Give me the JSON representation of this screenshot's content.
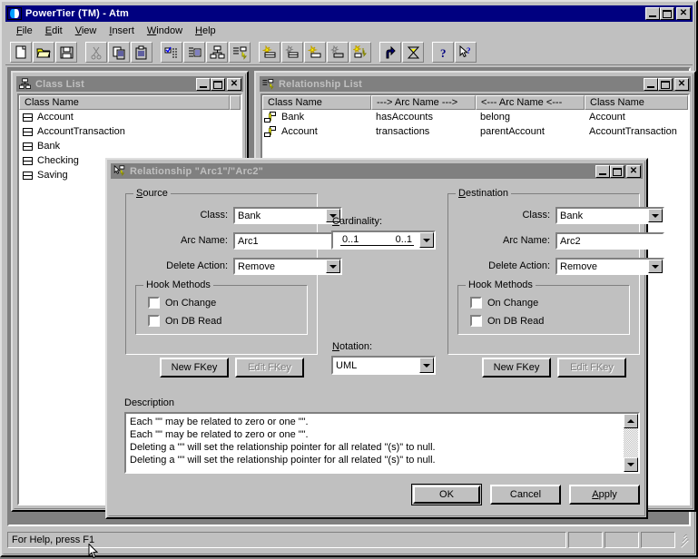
{
  "app": {
    "title": "PowerTier (TM) - Atm",
    "icon": "powertier-app-icon",
    "menus": [
      {
        "label": "File",
        "accel": "F"
      },
      {
        "label": "Edit",
        "accel": "E"
      },
      {
        "label": "View",
        "accel": "V"
      },
      {
        "label": "Insert",
        "accel": "I"
      },
      {
        "label": "Window",
        "accel": "W"
      },
      {
        "label": "Help",
        "accel": "H"
      }
    ],
    "window_buttons": [
      "minimize",
      "maximize",
      "close"
    ]
  },
  "toolbar": {
    "buttons": [
      {
        "name": "new-icon"
      },
      {
        "name": "open-folder-icon"
      },
      {
        "name": "save-disk-icon"
      },
      {
        "name": "separator"
      },
      {
        "name": "cut-scissors-icon"
      },
      {
        "name": "copy-icon"
      },
      {
        "name": "paste-icon"
      },
      {
        "name": "separator"
      },
      {
        "name": "property-list-icon"
      },
      {
        "name": "attribute-list-icon"
      },
      {
        "name": "class-list-icon"
      },
      {
        "name": "relationship-list-icon"
      },
      {
        "name": "separator"
      },
      {
        "name": "new-class-icon"
      },
      {
        "name": "new-attribute-icon"
      },
      {
        "name": "new-method-icon"
      },
      {
        "name": "new-property-icon"
      },
      {
        "name": "new-relationship-icon"
      },
      {
        "name": "separator"
      },
      {
        "name": "generate-icon"
      },
      {
        "name": "build-icon"
      },
      {
        "name": "separator"
      },
      {
        "name": "help-question-icon"
      },
      {
        "name": "context-help-icon"
      }
    ]
  },
  "class_list_window": {
    "title": "Class List",
    "icon": "class-list-icon",
    "column_header": "Class Name",
    "rows": [
      {
        "name": "Account"
      },
      {
        "name": "AccountTransaction"
      },
      {
        "name": "Bank"
      },
      {
        "name": "Checking"
      },
      {
        "name": "Saving"
      }
    ]
  },
  "relationship_list_window": {
    "title": "Relationship List",
    "icon": "relationship-list-icon",
    "columns": [
      "Class Name",
      "---> Arc Name --->",
      "<--- Arc Name <---",
      "Class Name"
    ],
    "rows": [
      {
        "source_class": "Bank",
        "forward_arc": "hasAccounts",
        "backward_arc": "belong",
        "dest_class": "Account"
      },
      {
        "source_class": "Account",
        "forward_arc": "transactions",
        "backward_arc": "parentAccount",
        "dest_class": "AccountTransaction"
      }
    ]
  },
  "dialog": {
    "title": "Relationship \"Arc1\"/\"Arc2\"",
    "icon": "relationship-icon",
    "source": {
      "legend": "Source",
      "legend_accel": "S",
      "class_label": "Class:",
      "class_value": "Bank",
      "arc_name_label": "Arc Name:",
      "arc_name_value": "Arc1",
      "delete_action_label": "Delete Action:",
      "delete_action_value": "Remove",
      "hook_methods": {
        "legend": "Hook Methods",
        "on_change_label": "On Change",
        "on_change_checked": false,
        "on_db_read_label": "On DB Read",
        "on_db_read_checked": false
      },
      "new_fkey_label": "New FKey",
      "edit_fkey_label": "Edit FKey",
      "edit_fkey_enabled": false
    },
    "center": {
      "cardinality_label": "Cardinality:",
      "cardinality_accel": "C",
      "cardinality_left": "0..1",
      "cardinality_right": "0..1",
      "notation_label": "Notation:",
      "notation_accel": "N",
      "notation_value": "UML"
    },
    "destination": {
      "legend": "Destination",
      "legend_accel": "D",
      "class_label": "Class:",
      "class_value": "Bank",
      "arc_name_label": "Arc Name:",
      "arc_name_value": "Arc2",
      "delete_action_label": "Delete Action:",
      "delete_action_value": "Remove",
      "hook_methods": {
        "legend": "Hook Methods",
        "on_change_label": "On Change",
        "on_change_checked": false,
        "on_db_read_label": "On DB Read",
        "on_db_read_checked": false
      },
      "new_fkey_label": "New FKey",
      "edit_fkey_label": "Edit FKey",
      "edit_fkey_enabled": false
    },
    "description": {
      "label": "Description",
      "lines": [
        "Each \"\" may be related to zero or one \"\".",
        "Each \"\" may be related to zero or one \"\".",
        "Deleting a \"\" will set the relationship pointer for all related \"(s)\" to null.",
        "Deleting a \"\" will set the relationship pointer for all related \"(s)\" to null."
      ]
    },
    "buttons": {
      "ok": "OK",
      "cancel": "Cancel",
      "apply": "Apply",
      "apply_accel": "A"
    },
    "window_buttons": [
      "minimize",
      "maximize",
      "close"
    ]
  },
  "status_bar": {
    "message": "For Help, press F1",
    "panes": [
      "",
      "",
      ""
    ]
  },
  "colors": {
    "face": "#c0c0c0",
    "title_active": "#000080",
    "title_inactive": "#808080",
    "shadow": "#808080",
    "accent_yellow": "#ffff00",
    "window_bg": "#ffffff"
  }
}
